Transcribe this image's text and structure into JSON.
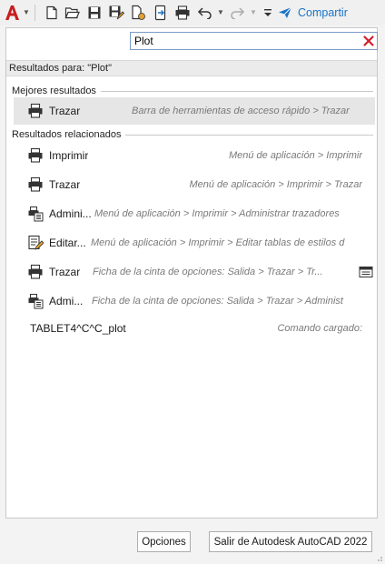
{
  "toolbar": {
    "share_label": "Compartir",
    "icons": [
      "autocad-app-icon",
      "new-icon",
      "open-icon",
      "save-icon",
      "save-as-icon",
      "open-from-web-icon",
      "save-to-web-icon",
      "plot-icon",
      "undo-icon",
      "redo-icon",
      "customize-qat-icon",
      "share-icon"
    ]
  },
  "search": {
    "value": "Plot"
  },
  "results_header": "Resultados para: \"Plot\"",
  "best": {
    "title": "Mejores resultados",
    "items": [
      {
        "label": "Trazar",
        "path": "Barra de herramientas de acceso rápido > Trazar",
        "icon": "printer-icon"
      }
    ]
  },
  "related": {
    "title": "Resultados relacionados",
    "items": [
      {
        "label": "Imprimir",
        "path": "Menú de aplicación > Imprimir",
        "icon": "printer-icon"
      },
      {
        "label": "Trazar",
        "path": "Menú de aplicación > Imprimir > Trazar",
        "icon": "printer-icon"
      },
      {
        "label": "Admini...",
        "path": "Menú de aplicación > Imprimir > Administrar trazadores",
        "icon": "plotter-manager-icon"
      },
      {
        "label": "Editar...",
        "path": "Menú de aplicación > Imprimir > Editar tablas de estilos d",
        "icon": "edit-plot-styles-icon"
      },
      {
        "label": "Trazar",
        "path": "Ficha de la cinta de opciones: Salida > Trazar > Tr...",
        "icon": "printer-icon"
      },
      {
        "label": "Admi...",
        "path": "Ficha de la cinta de opciones: Salida > Trazar > Administ",
        "icon": "plotter-manager-icon"
      },
      {
        "label": "TABLET4^C^C_plot",
        "path": "Comando cargado:",
        "icon": ""
      }
    ]
  },
  "buttons": {
    "options": "Opciones",
    "exit": "Salir de Autodesk AutoCAD 2022"
  },
  "colors": {
    "accent": "#1a73c9",
    "clear": "#d0202a",
    "app_red": "#c81e1e"
  }
}
